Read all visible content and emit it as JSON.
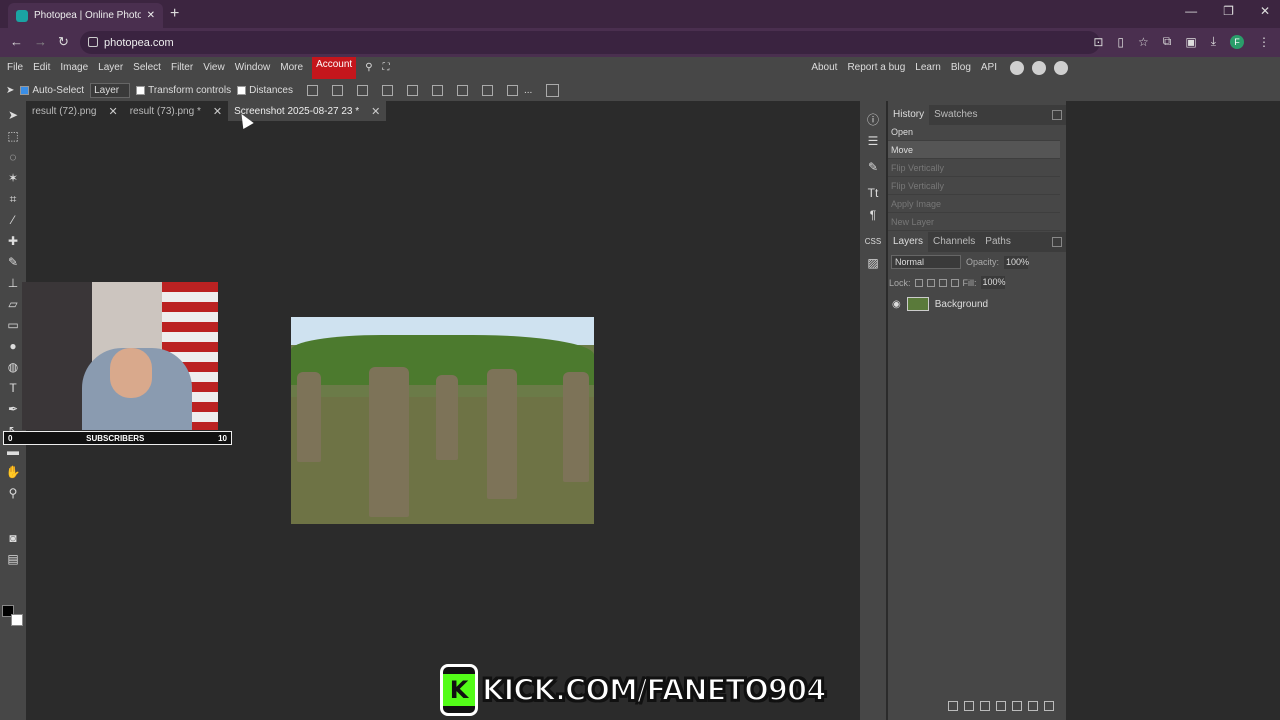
{
  "browser": {
    "tab_title": "Photopea | Online Photo Editor",
    "new_tab": "+",
    "url": "photopea.com",
    "window_min": "—",
    "window_max": "❐",
    "window_close": "✕",
    "back": "←",
    "forward": "→",
    "reload": "↻",
    "profile_initial": "F"
  },
  "menu": {
    "items": [
      "File",
      "Edit",
      "Image",
      "Layer",
      "Select",
      "Filter",
      "View",
      "Window",
      "More"
    ],
    "account": "Account",
    "right_items": [
      "About",
      "Report a bug",
      "Learn",
      "Blog",
      "API"
    ]
  },
  "options": {
    "auto_select": "Auto-Select",
    "layer_select": "Layer",
    "transform_controls": "Transform controls",
    "distances": "Distances",
    "more": "..."
  },
  "doc_tabs": [
    {
      "label": "result (72).png"
    },
    {
      "label": "result (73).png *"
    },
    {
      "label": "Screenshot 2025-08-27 23 *"
    }
  ],
  "close_glyph": "✕",
  "history": {
    "tabs": [
      "History",
      "Swatches"
    ],
    "items": [
      {
        "label": "Open",
        "state": "normal"
      },
      {
        "label": "Move",
        "state": "current"
      },
      {
        "label": "Flip Vertically",
        "state": "dim"
      },
      {
        "label": "Flip Vertically",
        "state": "dim"
      },
      {
        "label": "Apply Image",
        "state": "dim"
      },
      {
        "label": "New Layer",
        "state": "dim"
      }
    ]
  },
  "layers": {
    "tabs": [
      "Layers",
      "Channels",
      "Paths"
    ],
    "blend_mode": "Normal",
    "opacity_label": "Opacity:",
    "opacity_value": "100%",
    "lock_label": "Lock:",
    "fill_label": "Fill:",
    "fill_value": "100%",
    "layer_name": "Background"
  },
  "overlay": {
    "subscribers_left": "0",
    "subscribers_label": "SUBSCRIBERS",
    "subscribers_right": "10",
    "kick_letter": "K",
    "kick_text": "KICK.COM/FANETO904"
  },
  "colors": {
    "accent_account": "#c4161c",
    "kick_green": "#53fc18"
  }
}
